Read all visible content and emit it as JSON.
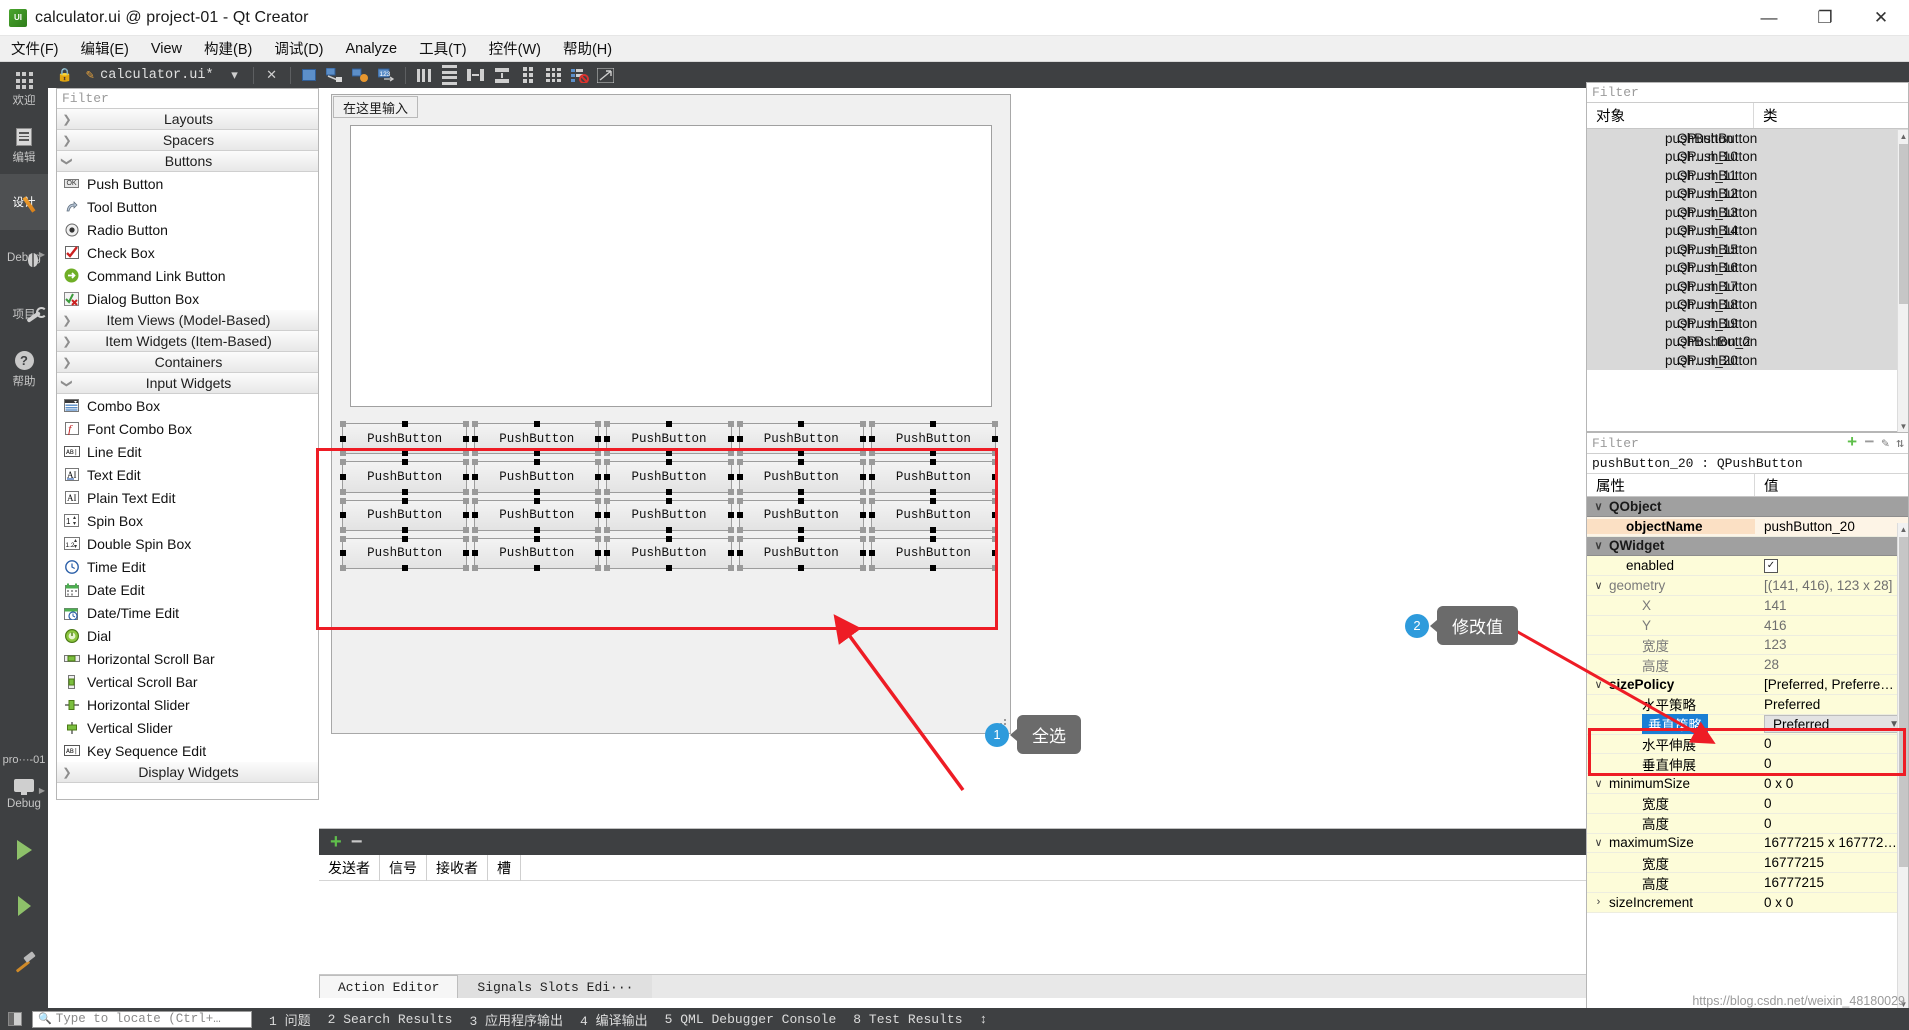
{
  "window": {
    "title": "calculator.ui @ project-01 - Qt Creator",
    "icon": "qt-ui-file-icon",
    "minimize": "—",
    "maximize": "❐",
    "close": "✕"
  },
  "menubar": {
    "items": [
      "文件(F)",
      "编辑(E)",
      "View",
      "构建(B)",
      "调试(D)",
      "Analyze",
      "工具(T)",
      "控件(W)",
      "帮助(H)"
    ]
  },
  "activitybar": {
    "items": [
      {
        "label": "欢迎",
        "icon": "grid-welcome-icon",
        "active": false,
        "arrow": false
      },
      {
        "label": "编辑",
        "icon": "document-edit-icon",
        "active": false,
        "arrow": false
      },
      {
        "label": "设计",
        "icon": "pencil-design-icon",
        "active": true,
        "arrow": false
      },
      {
        "label": "Debug",
        "icon": "bug-icon",
        "active": false,
        "arrow": true
      },
      {
        "label": "项目",
        "icon": "wrench-icon",
        "active": false,
        "arrow": false
      },
      {
        "label": "帮助",
        "icon": "question-mark-icon",
        "active": false,
        "arrow": false
      }
    ],
    "bottom": {
      "project_label": "pro···-01",
      "kit_label": "Debug",
      "kit_icon": "monitor-icon",
      "run_icon": "run-triangle-icon",
      "debug_icon": "run-debug-icon",
      "build_icon": "hammer-icon"
    }
  },
  "designer_toolbar": {
    "file_tab": "calculator.ui*",
    "file_tab_icon": "ui-file-icon",
    "dropdown_icon": "chevron-down-icon",
    "close_icon": "close-x-icon",
    "tools": [
      "edit-widgets-icon",
      "edit-signals-slots-icon",
      "edit-buddies-icon",
      "edit-tab-order-icon",
      "layout-horizontally-icon",
      "layout-vertically-icon",
      "layout-splitter-h-icon",
      "layout-splitter-v-icon",
      "layout-form-icon",
      "layout-grid-icon",
      "break-layout-icon",
      "adjust-size-icon"
    ]
  },
  "widget_box": {
    "filter_placeholder": "Filter",
    "groups": [
      {
        "label": "Layouts",
        "expanded": false,
        "items": []
      },
      {
        "label": "Spacers",
        "expanded": false,
        "items": []
      },
      {
        "label": "Buttons",
        "expanded": true,
        "items": [
          {
            "label": "Push Button",
            "icon": "push-button-icon"
          },
          {
            "label": "Tool Button",
            "icon": "tool-button-icon"
          },
          {
            "label": "Radio Button",
            "icon": "radio-button-icon"
          },
          {
            "label": "Check Box",
            "icon": "check-box-icon"
          },
          {
            "label": "Command Link Button",
            "icon": "command-link-button-icon"
          },
          {
            "label": "Dialog Button Box",
            "icon": "dialog-button-box-icon"
          }
        ]
      },
      {
        "label": "Item Views (Model-Based)",
        "expanded": false,
        "items": []
      },
      {
        "label": "Item Widgets (Item-Based)",
        "expanded": false,
        "items": []
      },
      {
        "label": "Containers",
        "expanded": false,
        "items": []
      },
      {
        "label": "Input Widgets",
        "expanded": true,
        "items": [
          {
            "label": "Combo Box",
            "icon": "combo-box-icon"
          },
          {
            "label": "Font Combo Box",
            "icon": "font-combo-box-icon"
          },
          {
            "label": "Line Edit",
            "icon": "line-edit-icon"
          },
          {
            "label": "Text Edit",
            "icon": "text-edit-icon"
          },
          {
            "label": "Plain Text Edit",
            "icon": "plain-text-edit-icon"
          },
          {
            "label": "Spin Box",
            "icon": "spin-box-icon"
          },
          {
            "label": "Double Spin Box",
            "icon": "double-spin-box-icon"
          },
          {
            "label": "Time Edit",
            "icon": "time-edit-icon"
          },
          {
            "label": "Date Edit",
            "icon": "date-edit-icon"
          },
          {
            "label": "Date/Time Edit",
            "icon": "date-time-edit-icon"
          },
          {
            "label": "Dial",
            "icon": "dial-icon"
          },
          {
            "label": "Horizontal Scroll Bar",
            "icon": "horizontal-scroll-bar-icon"
          },
          {
            "label": "Vertical Scroll Bar",
            "icon": "vertical-scroll-bar-icon"
          },
          {
            "label": "Horizontal Slider",
            "icon": "horizontal-slider-icon"
          },
          {
            "label": "Vertical Slider",
            "icon": "vertical-slider-icon"
          },
          {
            "label": "Key Sequence Edit",
            "icon": "key-sequence-edit-icon"
          }
        ]
      },
      {
        "label": "Display Widgets",
        "expanded": false,
        "items": []
      }
    ]
  },
  "form_editor": {
    "menu_placeholder": "在这里输入",
    "buttons": [
      [
        "PushButton",
        "PushButton",
        "PushButton",
        "PushButton",
        "PushButton"
      ],
      [
        "PushButton",
        "PushButton",
        "PushButton",
        "PushButton",
        "PushButton"
      ],
      [
        "PushButton",
        "PushButton",
        "PushButton",
        "PushButton",
        "PushButton"
      ],
      [
        "PushButton",
        "PushButton",
        "PushButton",
        "PushButton",
        "PushButton"
      ]
    ]
  },
  "signal_slot_editor": {
    "add_icon": "plus-icon",
    "remove_icon": "minus-icon",
    "columns": [
      "发送者",
      "信号",
      "接收者",
      "槽"
    ],
    "tabs": [
      {
        "label": "Action Editor",
        "active": true
      },
      {
        "label": "Signals  Slots Edi···",
        "active": false
      }
    ]
  },
  "object_inspector": {
    "filter_placeholder": "Filter",
    "columns": [
      "对象",
      "类"
    ],
    "rows": [
      {
        "object": "pushButton",
        "class": "QPushButton"
      },
      {
        "object": "push…n_10",
        "class": "QPushButton"
      },
      {
        "object": "push…n_11",
        "class": "QPushButton"
      },
      {
        "object": "push…n_12",
        "class": "QPushButton"
      },
      {
        "object": "push…n_13",
        "class": "QPushButton"
      },
      {
        "object": "push…n_14",
        "class": "QPushButton"
      },
      {
        "object": "push…n_15",
        "class": "QPushButton"
      },
      {
        "object": "push…n_16",
        "class": "QPushButton"
      },
      {
        "object": "push…n_17",
        "class": "QPushButton"
      },
      {
        "object": "push…n_18",
        "class": "QPushButton"
      },
      {
        "object": "push…n_19",
        "class": "QPushButton"
      },
      {
        "object": "pushB…ton_2",
        "class": "QPushButton"
      },
      {
        "object": "push…n_20",
        "class": "QPushButton"
      }
    ]
  },
  "property_editor": {
    "filter_placeholder": "Filter",
    "object_line": "pushButton_20 : QPushButton",
    "toolbar_icons": [
      "add-property-icon",
      "remove-property-icon",
      "configure-icon",
      "sort-icon"
    ],
    "columns": [
      "属性",
      "值"
    ],
    "rows": [
      {
        "kind": "group",
        "name": "QObject",
        "value": "",
        "chev": "∨"
      },
      {
        "kind": "orange",
        "name": "objectName",
        "value": "pushButton_20",
        "indent": 1
      },
      {
        "kind": "group",
        "name": "QWidget",
        "value": "",
        "chev": "∨"
      },
      {
        "kind": "yellow",
        "name": "enabled",
        "value": "",
        "widget": "checkbox",
        "checked": true,
        "indent": 1
      },
      {
        "kind": "yellow",
        "name": "geometry",
        "value": "[(141, 416), 123 x 28]",
        "chev": "∨",
        "dim": true
      },
      {
        "kind": "yellow",
        "name": "X",
        "value": "141",
        "indent": 2,
        "dim": true
      },
      {
        "kind": "yellow",
        "name": "Y",
        "value": "416",
        "indent": 2,
        "dim": true
      },
      {
        "kind": "yellow",
        "name": "宽度",
        "value": "123",
        "indent": 2,
        "dim": true
      },
      {
        "kind": "yellow",
        "name": "高度",
        "value": "28",
        "indent": 2,
        "dim": true
      },
      {
        "kind": "yellow",
        "name": "sizePolicy",
        "value": "[Preferred, Preferre…",
        "chev": "∨",
        "bold": true
      },
      {
        "kind": "yellow",
        "name": "水平策略",
        "value": "Preferred",
        "indent": 2
      },
      {
        "kind": "selected",
        "name": "垂直策略",
        "value": "Preferred",
        "indent": 2,
        "widget": "combo"
      },
      {
        "kind": "yellow",
        "name": "水平伸展",
        "value": "0",
        "indent": 2
      },
      {
        "kind": "yellow",
        "name": "垂直伸展",
        "value": "0",
        "indent": 2
      },
      {
        "kind": "yellow",
        "name": "minimumSize",
        "value": "0 x 0",
        "chev": "∨"
      },
      {
        "kind": "yellow",
        "name": "宽度",
        "value": "0",
        "indent": 2
      },
      {
        "kind": "yellow",
        "name": "高度",
        "value": "0",
        "indent": 2
      },
      {
        "kind": "yellow",
        "name": "maximumSize",
        "value": "16777215 x 167772…",
        "chev": "∨"
      },
      {
        "kind": "yellow",
        "name": "宽度",
        "value": "16777215",
        "indent": 2
      },
      {
        "kind": "yellow",
        "name": "高度",
        "value": "16777215",
        "indent": 2
      },
      {
        "kind": "yellow",
        "name": "sizeIncrement",
        "value": "0 x 0",
        "chev": "›"
      }
    ]
  },
  "annotations": [
    {
      "num": "1",
      "text": "全选"
    },
    {
      "num": "2",
      "text": "修改值"
    }
  ],
  "statusbar": {
    "locator_placeholder": "Type to locate (Ctrl+…",
    "search_icon": "search-icon",
    "sidebar_toggle_icon": "sidebar-toggle-icon",
    "items": [
      "1 问题",
      "2 Search Results",
      "3 应用程序输出",
      "4 编译输出",
      "5 QML Debugger Console",
      "8 Test Results"
    ],
    "updown_icon": "↕"
  },
  "watermark": "https://blog.csdn.net/weixin_48180029",
  "colors": {
    "accent_red": "#ee1c25",
    "callout_blue": "#2e9bdc",
    "dark_chrome": "#3e4042",
    "selection_blue": "#1a7fd4",
    "property_yellow": "#fdfcd9"
  }
}
